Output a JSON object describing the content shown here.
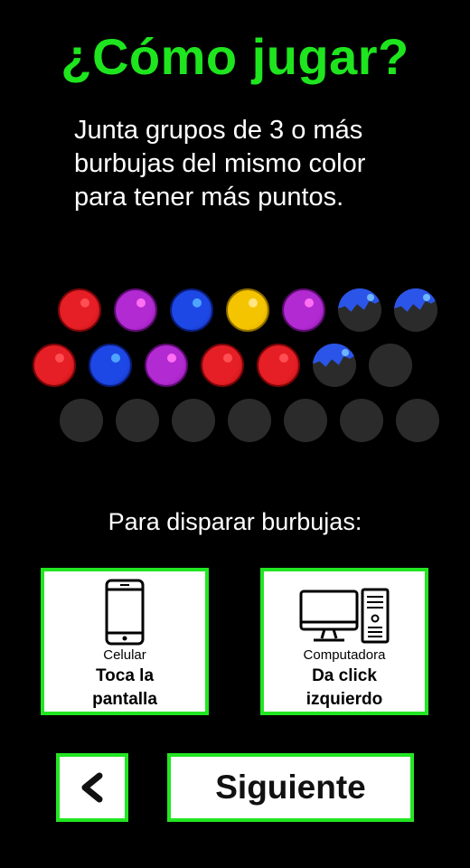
{
  "title": "¿Cómo jugar?",
  "description": [
    "Junta grupos de 3 o más",
    "burbujas del mismo color",
    "para tener más puntos."
  ],
  "board": {
    "rows": [
      [
        "red",
        "purple",
        "blue",
        "yellow",
        "purple",
        "cracked",
        "cracked"
      ],
      [
        "red",
        "blue",
        "purple",
        "red",
        "red",
        "cracked",
        "empty"
      ],
      [
        "empty",
        "empty",
        "empty",
        "empty",
        "empty",
        "empty",
        "empty"
      ]
    ]
  },
  "shoot_heading": "Para disparar burbujas:",
  "options": [
    {
      "caption": "Celular",
      "action": [
        "Toca la",
        "pantalla"
      ],
      "icon": "smartphone-icon"
    },
    {
      "caption": "Computadora",
      "action": [
        "Da click",
        "izquierdo"
      ],
      "icon": "desktop-computer-icon"
    }
  ],
  "nav": {
    "back_icon": "chevron-left-icon",
    "next_label": "Siguiente"
  },
  "colors": {
    "accent": "#22e622",
    "title": "#1ee51e",
    "background": "#000000"
  }
}
